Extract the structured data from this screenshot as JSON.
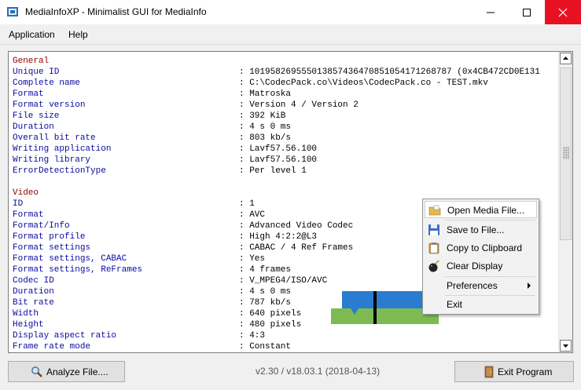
{
  "window": {
    "title": "MediaInfoXP - Minimalist GUI for MediaInfo"
  },
  "menu": {
    "application": "Application",
    "help": "Help"
  },
  "info_lines": [
    {
      "type": "section",
      "text": "General"
    },
    {
      "type": "row",
      "key": "Unique ID",
      "value": "101958269555013857436470851054171268787 (0x4CB472CD0E131"
    },
    {
      "type": "row",
      "key": "Complete name",
      "value": "C:\\CodecPack.co\\Videos\\CodecPack.co - TEST.mkv"
    },
    {
      "type": "row",
      "key": "Format",
      "value": "Matroska"
    },
    {
      "type": "row",
      "key": "Format version",
      "value": "Version 4 / Version 2"
    },
    {
      "type": "row",
      "key": "File size",
      "value": "392 KiB"
    },
    {
      "type": "row",
      "key": "Duration",
      "value": "4 s 0 ms"
    },
    {
      "type": "row",
      "key": "Overall bit rate",
      "value": "803 kb/s"
    },
    {
      "type": "row",
      "key": "Writing application",
      "value": "Lavf57.56.100"
    },
    {
      "type": "row",
      "key": "Writing library",
      "value": "Lavf57.56.100"
    },
    {
      "type": "row",
      "key": "ErrorDetectionType",
      "value": "Per level 1"
    },
    {
      "type": "blank",
      "text": ""
    },
    {
      "type": "section",
      "text": "Video"
    },
    {
      "type": "row",
      "key": "ID",
      "value": "1"
    },
    {
      "type": "row",
      "key": "Format",
      "value": "AVC"
    },
    {
      "type": "row",
      "key": "Format/Info",
      "value": "Advanced Video Codec"
    },
    {
      "type": "row",
      "key": "Format profile",
      "value": "High 4:2:2@L3"
    },
    {
      "type": "row",
      "key": "Format settings",
      "value": "CABAC / 4 Ref Frames"
    },
    {
      "type": "row",
      "key": "Format settings, CABAC",
      "value": "Yes"
    },
    {
      "type": "row",
      "key": "Format settings, ReFrames",
      "value": "4 frames"
    },
    {
      "type": "row",
      "key": "Codec ID",
      "value": "V_MPEG4/ISO/AVC"
    },
    {
      "type": "row",
      "key": "Duration",
      "value": "4 s 0 ms"
    },
    {
      "type": "row",
      "key": "Bit rate",
      "value": "787 kb/s"
    },
    {
      "type": "row",
      "key": "Width",
      "value": "640 pixels"
    },
    {
      "type": "row",
      "key": "Height",
      "value": "480 pixels"
    },
    {
      "type": "row",
      "key": "Display aspect ratio",
      "value": "4:3"
    },
    {
      "type": "row",
      "key": "Frame rate mode",
      "value": "Constant"
    }
  ],
  "context_menu": {
    "open": "Open Media File...",
    "save": "Save to File...",
    "copy": "Copy to Clipboard",
    "clear": "Clear Display",
    "preferences": "Preferences",
    "exit": "Exit"
  },
  "footer": {
    "analyze_label": "Analyze File....",
    "version": "v2.30 / v18.03.1 (2018-04-13)",
    "exit_label": "Exit Program"
  },
  "icons": {
    "app": "app-icon",
    "analyze": "magnifier-icon",
    "exit": "exit-door-icon",
    "open": "open-folder-icon",
    "save": "floppy-disk-icon",
    "copy": "clipboard-icon",
    "clear": "bomb-icon"
  },
  "colors": {
    "section": "#8b0000",
    "key": "#0a0aa0",
    "close_button": "#e81123"
  }
}
